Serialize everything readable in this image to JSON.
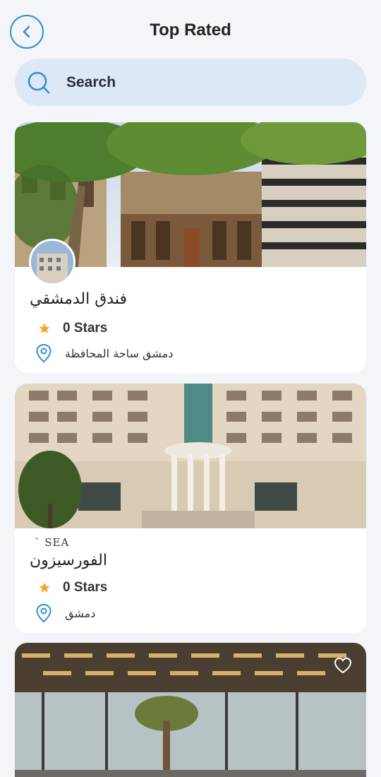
{
  "header": {
    "title": "Top Rated",
    "back_icon": "chevron-left-icon"
  },
  "search": {
    "placeholder": "Search",
    "icon": "search-icon"
  },
  "colors": {
    "accent": "#2f8fd6",
    "star": "#f5a623",
    "search_bg": "#dde8f6",
    "page_bg": "#f3f5f9"
  },
  "hotels": [
    {
      "name": "فندق الدمشقي",
      "stars": "0 Stars",
      "location": "دمشق ساحة المحافظة"
    },
    {
      "name": "الفورسيزون",
      "stars": "0 Stars",
      "location": "دمشق",
      "logo_text": "` SEA"
    },
    {
      "favorite_icon": "heart-outline-icon"
    }
  ]
}
